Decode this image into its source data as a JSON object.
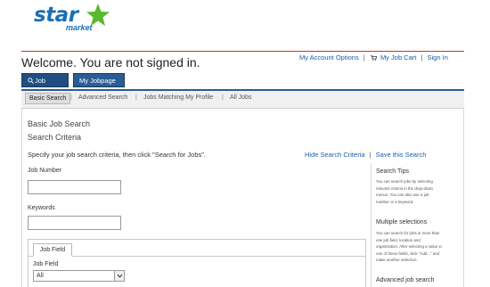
{
  "brand": {
    "logo_word": "star",
    "logo_sub": "market",
    "colors": {
      "logo_blue": "#1a6fb5",
      "logo_green": "#5cb82e",
      "nav_blue": "#1f4f82",
      "link_blue": "#1a5fa8",
      "accent_red": "#c0392b"
    }
  },
  "header": {
    "welcome": "Welcome. You are not signed in.",
    "links": {
      "account": "My Account Options",
      "cart": "My Job Cart",
      "signin": "Sign In",
      "sep": "|",
      "cart_icon": "cart-icon"
    }
  },
  "nav": {
    "job_search": "Job Search",
    "job_search_icon": "search-icon",
    "jobpage": "My Jobpage"
  },
  "subtabs": {
    "basic": "Basic Search",
    "advanced": "Advanced Search",
    "matching": "Jobs Matching My Profile",
    "all": "All Jobs",
    "sep": "|"
  },
  "main": {
    "heading": "Basic Job Search",
    "subheading": "Search Criteria",
    "instructions": "Specify your job search criteria, then click \"Search for Jobs\".",
    "hide_link": "Hide Search Criteria",
    "save_link": "Save this Search",
    "sep": "|",
    "job_number": {
      "label": "Job Number",
      "value": ""
    },
    "keywords": {
      "label": "Keywords",
      "value": ""
    },
    "job_field_tab": "Job Field",
    "job_field": {
      "label": "Job Field",
      "selected": "All"
    }
  },
  "tips": {
    "search_tips": {
      "title": "Search Tips",
      "body": "You can search jobs by selecting relevant criteria in the drop-down menus. You can also use a job number or a keyword."
    },
    "multiple": {
      "title": "Multiple selections",
      "body": "You can search for jobs in more than one job field, location and organization. After selecting a value in one of these fields, click \"Add...\" and make another selection."
    },
    "advanced": {
      "title": "Advanced job search"
    }
  }
}
